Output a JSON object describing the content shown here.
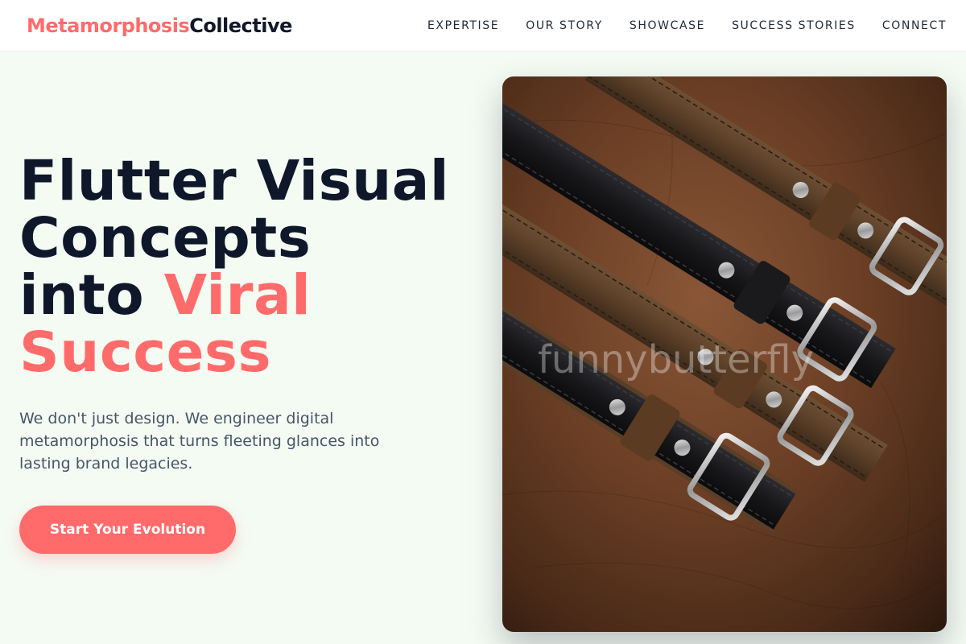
{
  "brand": {
    "name_accent": "Metamorphosis",
    "name_rest": "Collective"
  },
  "nav": {
    "items": [
      "EXPERTISE",
      "OUR STORY",
      "SHOWCASE",
      "SUCCESS STORIES",
      "CONNECT"
    ]
  },
  "hero": {
    "headline_line1": "Flutter Visual",
    "headline_line2": "Concepts",
    "headline_line3_dark": "into",
    "headline_line3_accent": "Viral",
    "headline_line4_accent": "Success",
    "description": "We don't just design. We engineer digital metamorphosis that turns fleeting glances into lasting brand legacies.",
    "cta_label": "Start Your Evolution"
  },
  "image": {
    "subject": "leather belts on leather background",
    "watermark": "funnybutterfly"
  },
  "colors": {
    "accent": "#ff6b6b",
    "dark": "#0f172a",
    "background": "#f4fbf3",
    "muted_text": "#475569"
  }
}
